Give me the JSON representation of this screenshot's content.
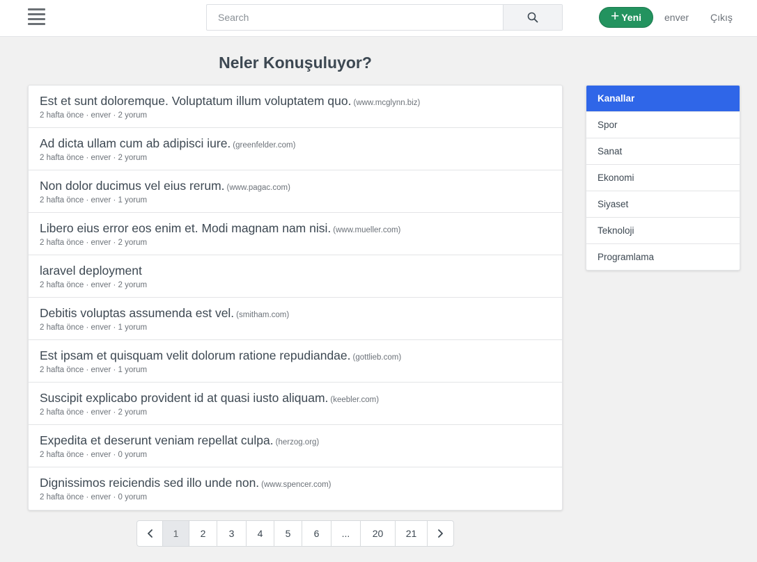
{
  "navbar": {
    "search_placeholder": "Search",
    "new_button_icon": "+",
    "new_button_label": "Yeni",
    "user_link": "enver",
    "logout_link": "Çıkış",
    "accent_color": "#23935f"
  },
  "main": {
    "title": "Neler Konuşuluyor?",
    "threads": [
      {
        "title": "Est et sunt doloremque. Voluptatum illum voluptatem quo.",
        "domain": "(www.mcglynn.biz)",
        "meta": "2 hafta önce · enver · 2 yorum"
      },
      {
        "title": "Ad dicta ullam cum ab adipisci iure.",
        "domain": "(greenfelder.com)",
        "meta": "2 hafta önce · enver · 2 yorum"
      },
      {
        "title": "Non dolor ducimus vel eius rerum.",
        "domain": "(www.pagac.com)",
        "meta": "2 hafta önce · enver · 1 yorum"
      },
      {
        "title": "Libero eius error eos enim et. Modi magnam nam nisi.",
        "domain": "(www.mueller.com)",
        "meta": "2 hafta önce · enver · 2 yorum"
      },
      {
        "title": "laravel deployment",
        "domain": "",
        "meta": "2 hafta önce · enver · 2 yorum"
      },
      {
        "title": "Debitis voluptas assumenda est vel.",
        "domain": "(smitham.com)",
        "meta": "2 hafta önce · enver · 1 yorum"
      },
      {
        "title": "Est ipsam et quisquam velit dolorum ratione repudiandae.",
        "domain": "(gottlieb.com)",
        "meta": "2 hafta önce · enver · 1 yorum"
      },
      {
        "title": "Suscipit explicabo provident id at quasi iusto aliquam.",
        "domain": "(keebler.com)",
        "meta": "2 hafta önce · enver · 2 yorum"
      },
      {
        "title": "Expedita et deserunt veniam repellat culpa.",
        "domain": "(herzog.org)",
        "meta": "2 hafta önce · enver · 0 yorum"
      },
      {
        "title": "Dignissimos reiciendis sed illo unde non.",
        "domain": "(www.spencer.com)",
        "meta": "2 hafta önce · enver · 0 yorum"
      }
    ]
  },
  "pagination": {
    "prev_icon": "chevron-left-icon",
    "next_icon": "chevron-right-icon",
    "pages": [
      "1",
      "2",
      "3",
      "4",
      "5",
      "6",
      "...",
      "20",
      "21"
    ],
    "active": "1"
  },
  "sidebar": {
    "header": "Kanallar",
    "header_color": "#2f66e8",
    "items": [
      "Spor",
      "Sanat",
      "Ekonomi",
      "Siyaset",
      "Teknoloji",
      "Programlama"
    ]
  }
}
